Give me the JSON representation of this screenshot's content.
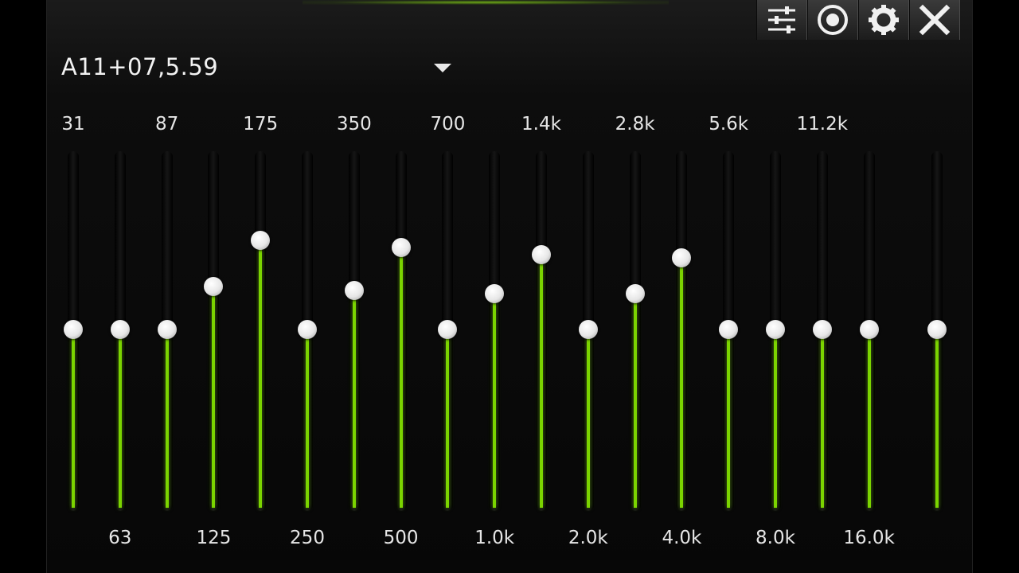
{
  "preset": {
    "name": "A11+07,5.59",
    "icon": "dropdown-arrow-icon"
  },
  "window_controls": [
    {
      "name": "sliders-button",
      "icon": "sliders-icon"
    },
    {
      "name": "record-button",
      "icon": "target-icon"
    },
    {
      "name": "settings-button",
      "icon": "gear-icon"
    },
    {
      "name": "close-button",
      "icon": "close-icon"
    }
  ],
  "colors": {
    "accent": "#7bd400",
    "knob": "#f0f0f0",
    "background": "#0d0d0d"
  },
  "bands": [
    {
      "label": "31",
      "level": 0.5
    },
    {
      "label": "63",
      "level": 0.5
    },
    {
      "label": "87",
      "level": 0.5
    },
    {
      "label": "125",
      "level": 0.62
    },
    {
      "label": "175",
      "level": 0.75
    },
    {
      "label": "250",
      "level": 0.5
    },
    {
      "label": "350",
      "level": 0.61
    },
    {
      "label": "500",
      "level": 0.73
    },
    {
      "label": "700",
      "level": 0.5
    },
    {
      "label": "1.0k",
      "level": 0.6
    },
    {
      "label": "1.4k",
      "level": 0.71
    },
    {
      "label": "2.0k",
      "level": 0.5
    },
    {
      "label": "2.8k",
      "level": 0.6
    },
    {
      "label": "4.0k",
      "level": 0.7
    },
    {
      "label": "5.6k",
      "level": 0.5
    },
    {
      "label": "8.0k",
      "level": 0.5
    },
    {
      "label": "11.2k",
      "level": 0.5
    },
    {
      "label": "16.0k",
      "level": 0.5
    }
  ],
  "preamp": {
    "level": 0.5
  }
}
